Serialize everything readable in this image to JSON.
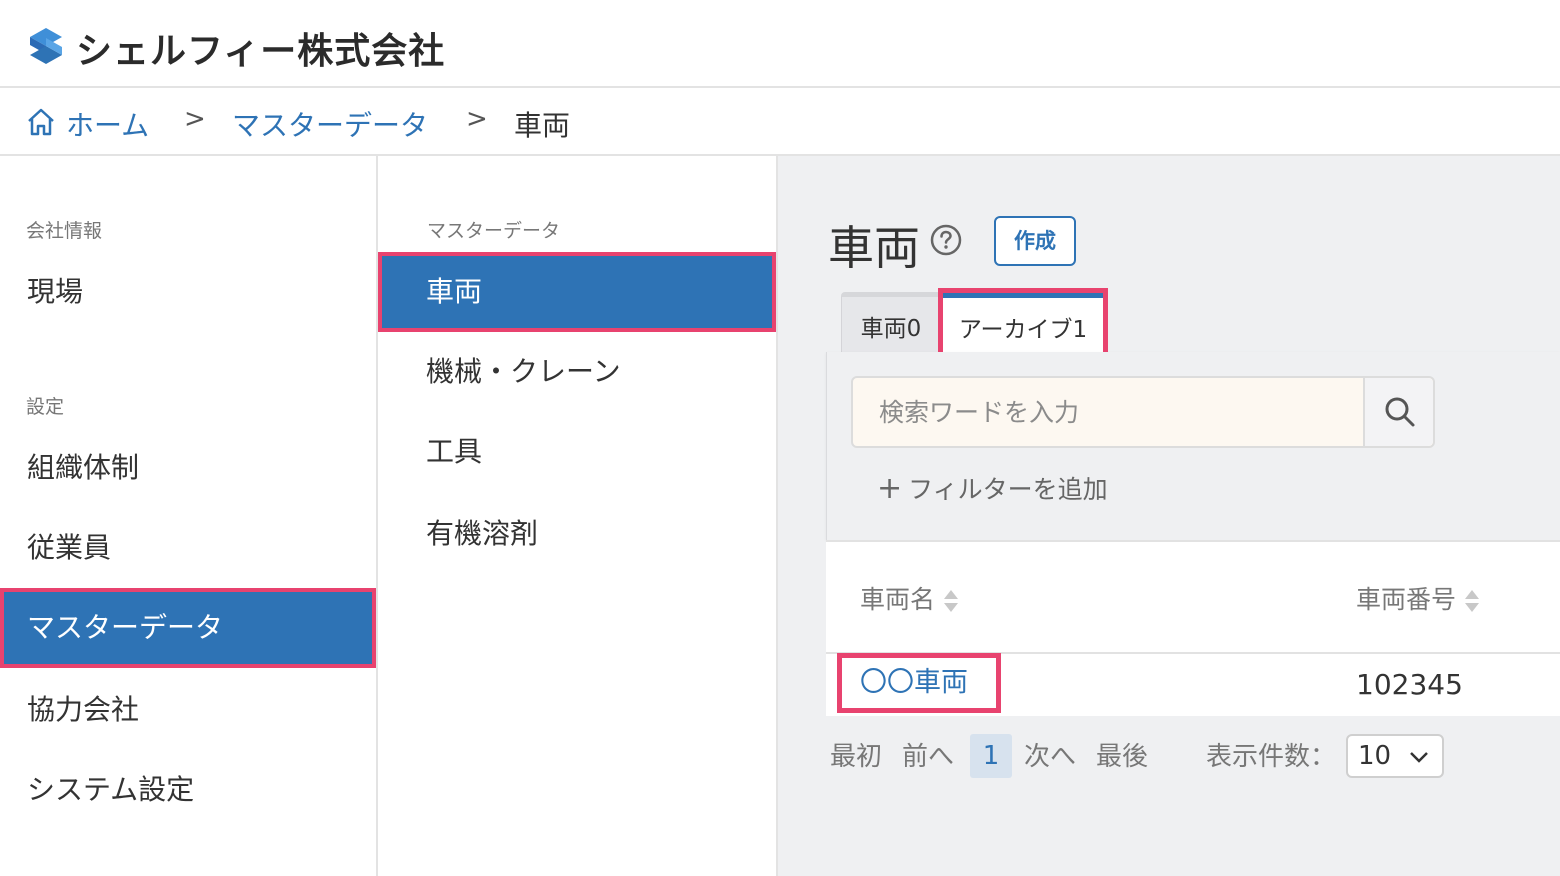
{
  "header": {
    "company": "シェルフィー株式会社",
    "logo_icon": "shelfy-logo",
    "accent": "#2e73b5"
  },
  "breadcrumb": {
    "home": "ホーム",
    "master": "マスターデータ",
    "current": "車両",
    "separator": ">"
  },
  "sidebar": {
    "section_company": "会社情報",
    "site": "現場",
    "section_settings": "設定",
    "items": [
      "組織体制",
      "従業員",
      "マスターデータ",
      "協力会社",
      "システム設定"
    ],
    "active": "マスターデータ"
  },
  "subbar": {
    "section": "マスターデータ",
    "items": [
      "車両",
      "機械・クレーン",
      "工具",
      "有機溶剤"
    ],
    "active": "車両"
  },
  "main": {
    "title": "車両",
    "help_icon": "question-circle-icon",
    "create": "作成",
    "tabs": [
      {
        "label": "車両0",
        "selected": false
      },
      {
        "label": "アーカイブ1",
        "selected": true
      }
    ],
    "search_placeholder": "検索ワードを入力",
    "add_filter": "フィルターを追加",
    "add_filter_icon": "+",
    "columns": [
      "車両名",
      "車両番号"
    ],
    "rows": [
      {
        "name": "〇〇車両",
        "number": "102345"
      }
    ],
    "pager": {
      "first": "最初",
      "prev": "前へ",
      "current": "1",
      "next": "次へ",
      "last": "最後",
      "page_size_label": "表示件数：",
      "page_size": "10"
    }
  },
  "colors": {
    "highlight": "#e8436f",
    "active_bg": "#2e73b5"
  }
}
